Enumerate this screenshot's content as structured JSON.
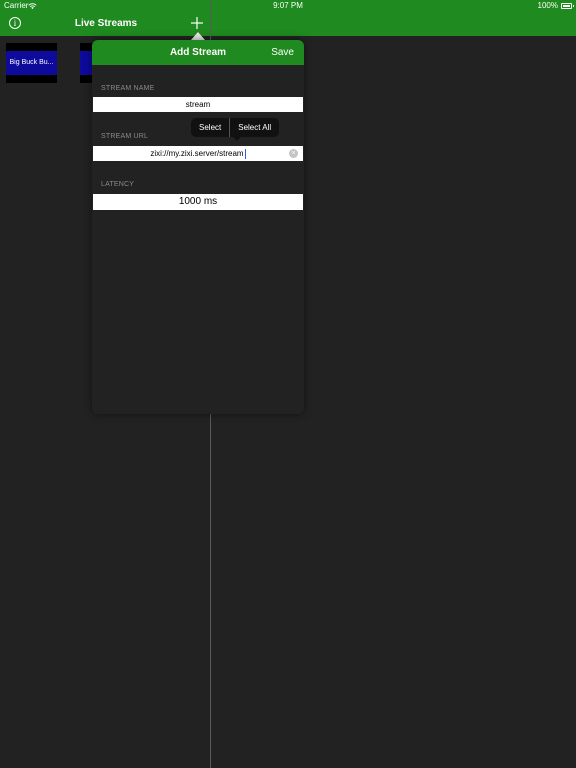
{
  "status_bar": {
    "carrier": "Carrier",
    "time": "9:07 PM",
    "battery": "100%"
  },
  "nav": {
    "title": "Live Streams"
  },
  "streams": [
    {
      "label": "Big Buck Bu..."
    },
    {
      "label": ""
    }
  ],
  "popover": {
    "title": "Add Stream",
    "save_label": "Save",
    "stream_name_label": "STREAM NAME",
    "stream_name_value": "stream",
    "stream_url_label": "STREAM URL",
    "stream_url_value": "zixi://my.zixi.server/stream",
    "latency_label": "LATENCY",
    "latency_value": "1000 ms"
  },
  "edit_menu": {
    "select_label": "Select",
    "select_all_label": "Select All"
  },
  "colors": {
    "accent_green": "#1f8a1f",
    "background": "#222222",
    "thumb_blue": "#0d0a9c",
    "cursor_blue": "#2f5fe6"
  },
  "icons": [
    "wifi-icon",
    "battery-icon",
    "info-icon",
    "plus-icon",
    "clear-icon"
  ]
}
